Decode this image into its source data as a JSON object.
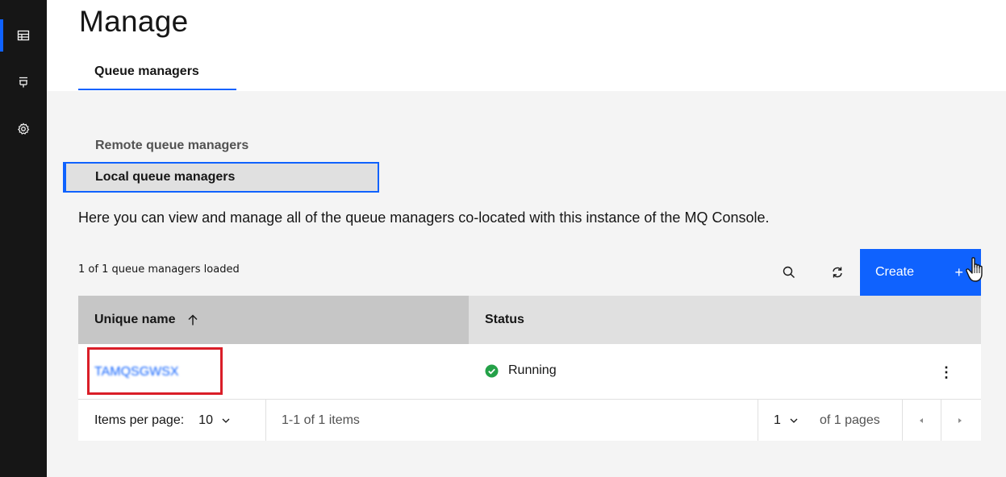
{
  "rail": {
    "items": [
      {
        "icon": "grid-icon",
        "active": true
      },
      {
        "icon": "object-storage-icon",
        "active": false
      },
      {
        "icon": "settings-icon",
        "active": false
      }
    ]
  },
  "header": {
    "title": "Manage",
    "tab": "Queue managers"
  },
  "subnav": {
    "remote": "Remote queue managers",
    "local": "Local queue managers"
  },
  "description": "Here you can view and manage all of the queue managers co-located with this instance of the MQ Console.",
  "toolbar": {
    "loaded_text": "1 of 1 queue managers loaded",
    "create_label": "Create",
    "create_plus": "+"
  },
  "table": {
    "headers": {
      "name": "Unique name",
      "status": "Status"
    },
    "rows": [
      {
        "name": "TAMQSGWSX",
        "status": "Running"
      }
    ],
    "overflow": "⋮"
  },
  "pagination": {
    "items_per_page_label": "Items per page:",
    "items_per_page": "10",
    "range": "1-1 of 1 items",
    "page": "1",
    "of_pages": "of 1 pages"
  },
  "colors": {
    "accent": "#0f62fe",
    "running": "#24a148",
    "highlight": "#da1e28"
  }
}
